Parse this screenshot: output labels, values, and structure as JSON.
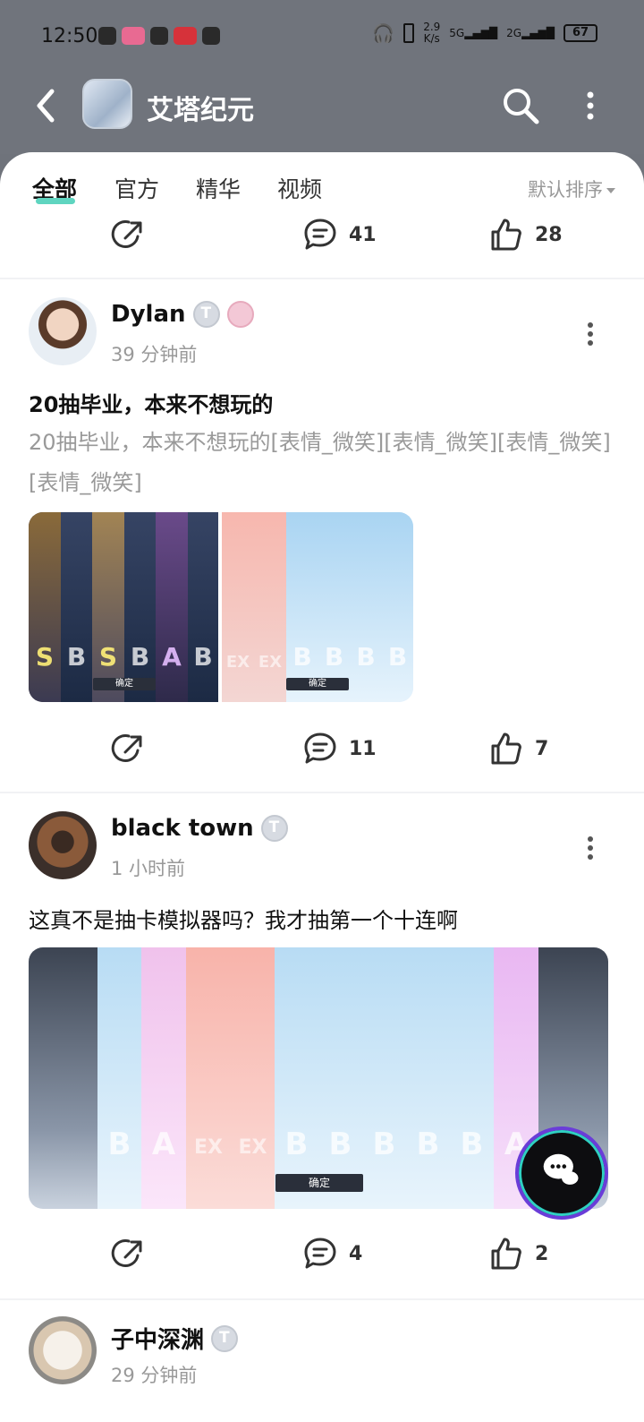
{
  "status_bar": {
    "time": "12:50",
    "net_speed_value": "2.9",
    "net_speed_unit": "K/s",
    "signal_1": "5G",
    "signal_2": "2G",
    "battery": "67"
  },
  "app_bar": {
    "title": "艾塔纪元"
  },
  "tabs": [
    {
      "label": "全部",
      "active": true
    },
    {
      "label": "官方",
      "active": false
    },
    {
      "label": "精华",
      "active": false
    },
    {
      "label": "视频",
      "active": false
    }
  ],
  "sort": {
    "label": "默认排序"
  },
  "top_actions": {
    "comments": "41",
    "likes": "28"
  },
  "posts": [
    {
      "username": "Dylan",
      "time_ago": "39 分钟前",
      "title": "20抽毕业，本来不想玩的",
      "body": "20抽毕业，本来不想玩的[表情_微笑][表情_微笑][表情_微笑][表情_微笑]",
      "image_1_ranks": [
        "S",
        "B",
        "S",
        "B",
        "A",
        "B"
      ],
      "image_2_ranks": [
        "EX",
        "EX",
        "B",
        "B",
        "B",
        "B"
      ],
      "confirm_label": "确定",
      "comments": "11",
      "likes": "7"
    },
    {
      "username": "black town",
      "time_ago": "1 小时前",
      "text": "这真不是抽卡模拟器吗？我才抽第一个十连啊",
      "image_ranks": [
        "B",
        "A",
        "EX",
        "EX",
        "B",
        "B",
        "B",
        "B",
        "B",
        "A"
      ],
      "confirm_label": "确定",
      "comments": "4",
      "likes": "2"
    },
    {
      "username": "子中深渊",
      "time_ago": "29 分钟前"
    }
  ],
  "colors": {
    "accent": "#5fd5c0",
    "header_bg": "#70747c",
    "muted_text": "#999999"
  }
}
